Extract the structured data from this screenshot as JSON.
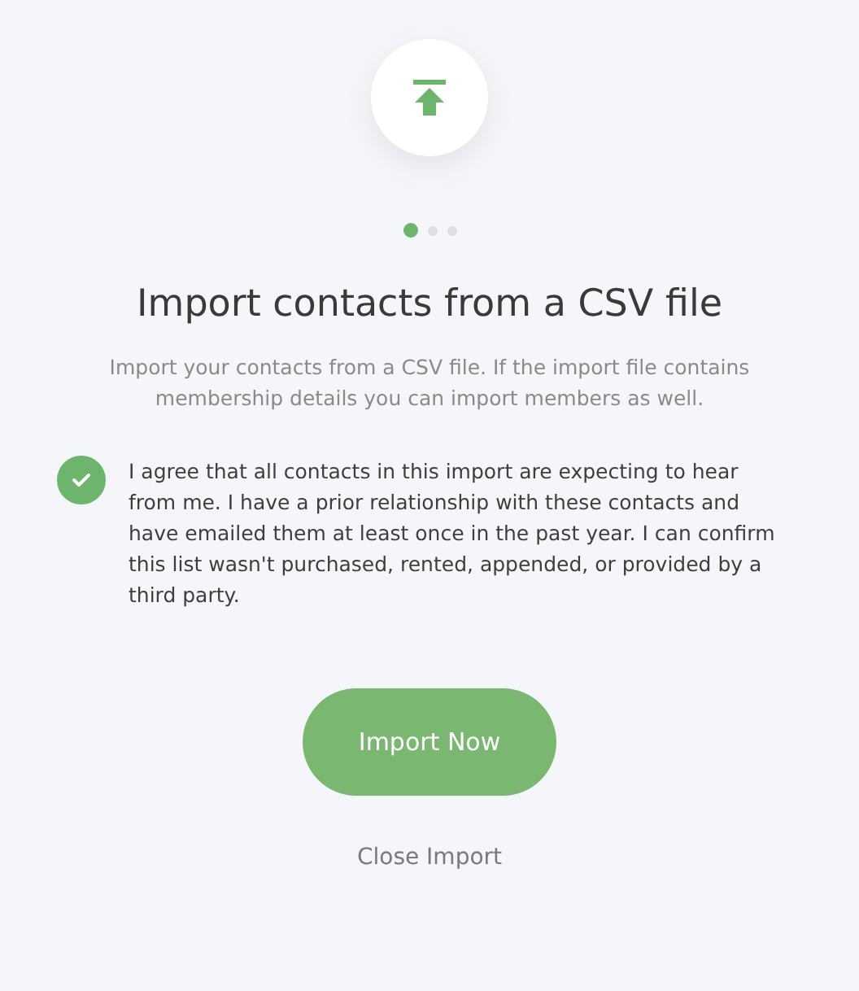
{
  "steps": [
    {
      "selected": true
    },
    {
      "selected": false
    },
    {
      "selected": false
    }
  ],
  "title": "Import contacts from a CSV file",
  "description": "Import your contacts from a CSV file. If the import file contains membership details you can import members as well.",
  "agreement": {
    "checked": true,
    "text": "I agree that all contacts in this import are expecting to hear from me. I have a prior relationship with these contacts and have emailed them at least once in the past year. I can confirm this list wasn't purchased, rented, appended, or provided by a third party."
  },
  "primary_button": "Import Now",
  "close_link": "Close Import"
}
